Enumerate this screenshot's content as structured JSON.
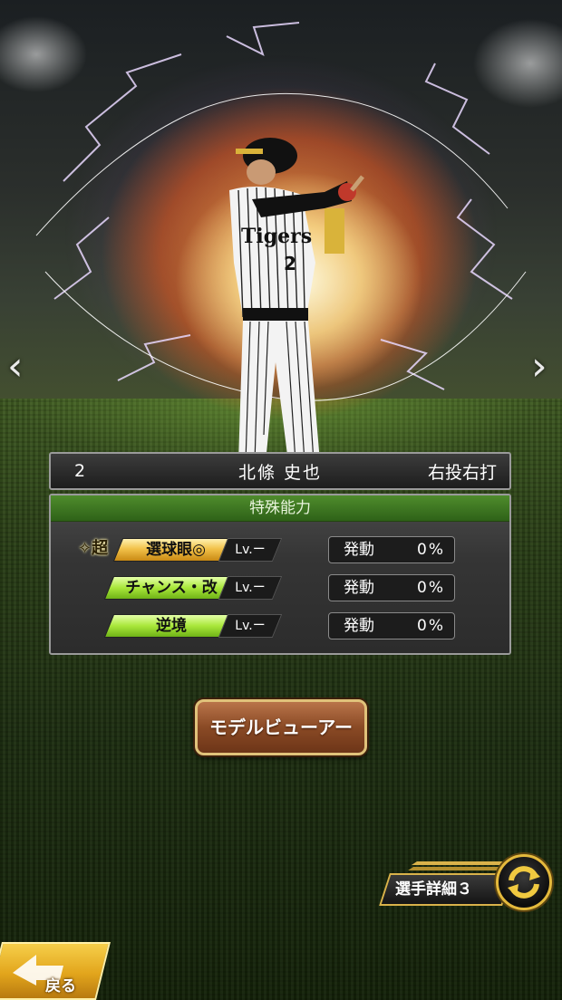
{
  "player": {
    "number": "2",
    "name": "北條 史也",
    "handedness": "右投右打",
    "uniform_text": "Tigers",
    "uniform_number": "2"
  },
  "abilities": {
    "title": "特殊能力",
    "items": [
      {
        "prefix": "超",
        "name": "選球眼◎",
        "level": "Lv.ー",
        "activation_label": "発動",
        "activation_value": "0%",
        "style": "gold"
      },
      {
        "prefix": "",
        "name": "チャンス・改",
        "level": "Lv.ー",
        "activation_label": "発動",
        "activation_value": "0%",
        "style": "green"
      },
      {
        "prefix": "",
        "name": "逆境",
        "level": "Lv.ー",
        "activation_label": "発動",
        "activation_value": "0%",
        "style": "green"
      }
    ]
  },
  "buttons": {
    "model_viewer": "モデルビューアー",
    "player_detail": "選手詳細３",
    "back": "戻る"
  },
  "icons": {
    "prev": "chevron-left-icon",
    "next": "chevron-right-icon",
    "cycle": "cycle-arrows-icon",
    "back": "back-arrow-icon"
  },
  "colors": {
    "ability_header": "#3f7a22",
    "gold_skill": "#f2c24a",
    "green_skill": "#a9e73a",
    "button_gold_border": "#e0c27a"
  }
}
